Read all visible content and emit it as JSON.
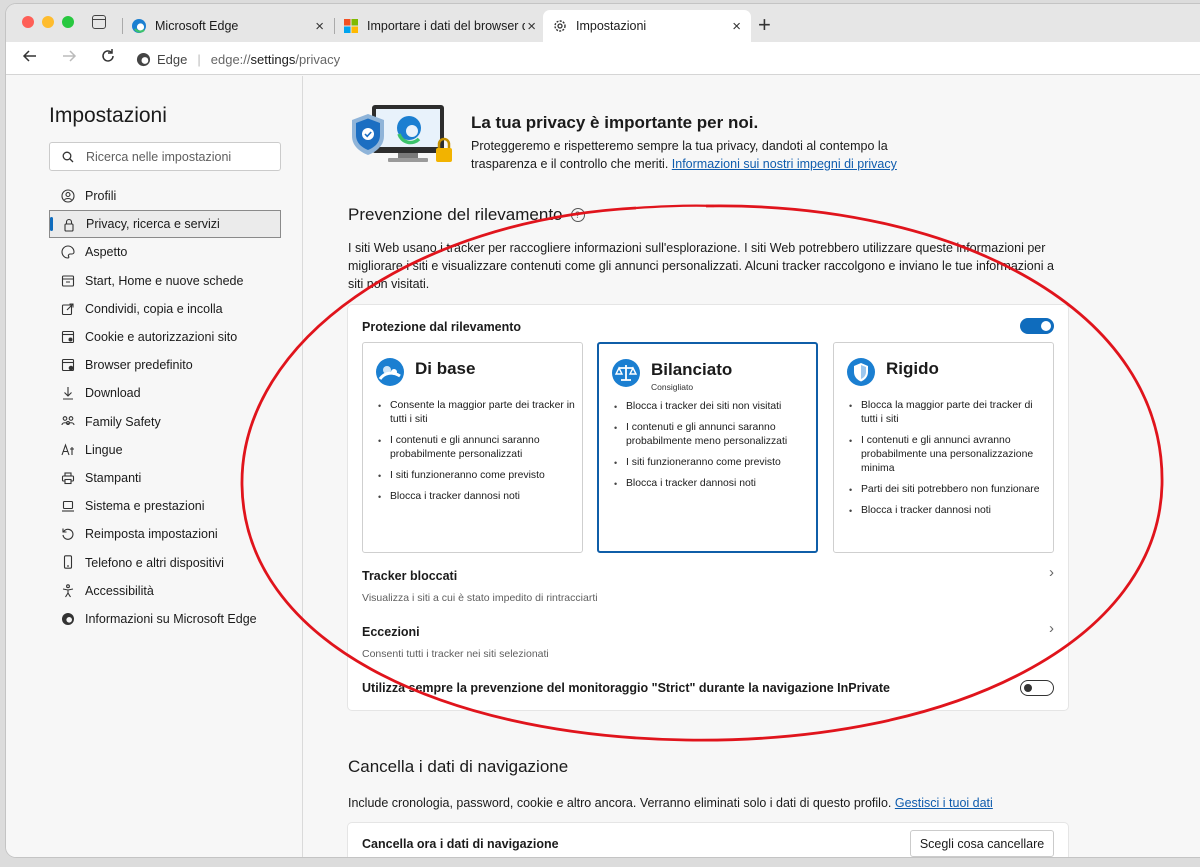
{
  "tabs": [
    {
      "title": "Microsoft Edge",
      "close": "×",
      "icon": "edge-logo"
    },
    {
      "title": "Importare i dati del browser da",
      "close": "×",
      "icon": "microsoft-logo"
    },
    {
      "title": "Impostazioni",
      "close": "×",
      "icon": "gear-icon"
    }
  ],
  "newtab": "+",
  "address": {
    "brand": "Edge",
    "separator": "|",
    "url_prefix": "edge://",
    "url_host": "settings",
    "url_path": "/privacy"
  },
  "sidebar": {
    "title": "Impostazioni",
    "search_placeholder": "Ricerca nelle impostazioni",
    "items": [
      {
        "label": "Profili",
        "icon": "profile-icon"
      },
      {
        "label": "Privacy, ricerca e servizi",
        "icon": "lock-icon"
      },
      {
        "label": "Aspetto",
        "icon": "palette-icon"
      },
      {
        "label": "Start, Home e nuove schede",
        "icon": "home-icon"
      },
      {
        "label": "Condividi, copia e incolla",
        "icon": "share-icon"
      },
      {
        "label": "Cookie e autorizzazioni sito",
        "icon": "cookie-icon"
      },
      {
        "label": "Browser predefinito",
        "icon": "browser-icon"
      },
      {
        "label": "Download",
        "icon": "download-icon"
      },
      {
        "label": "Family Safety",
        "icon": "family-icon"
      },
      {
        "label": "Lingue",
        "icon": "language-icon"
      },
      {
        "label": "Stampanti",
        "icon": "printer-icon"
      },
      {
        "label": "Sistema e prestazioni",
        "icon": "laptop-icon"
      },
      {
        "label": "Reimposta impostazioni",
        "icon": "reset-icon"
      },
      {
        "label": "Telefono e altri dispositivi",
        "icon": "phone-icon"
      },
      {
        "label": "Accessibilità",
        "icon": "accessibility-icon"
      },
      {
        "label": "Informazioni su Microsoft Edge",
        "icon": "edge-logo"
      }
    ]
  },
  "hero": {
    "title": "La tua privacy è importante per noi.",
    "desc": "Proteggeremo e rispetteremo sempre la tua privacy, dandoti al contempo la trasparenza e il controllo che meriti. ",
    "link": "Informazioni sui nostri impegni di privacy"
  },
  "tracking": {
    "title": "Prevenzione del rilevamento",
    "help": "?",
    "desc": "I siti Web usano i tracker per raccogliere informazioni sull'esplorazione. I siti Web potrebbero utilizzare queste informazioni per migliorare i siti e visualizzare contenuti come gli annunci personalizzati. Alcuni tracker raccolgono e inviano le tue informazioni a siti non visitati.",
    "protection_label": "Protezione dal rilevamento",
    "protection_on": true,
    "levels": [
      {
        "name": "Di base",
        "sub": "",
        "selected": false,
        "bullets": [
          "Consente la maggior parte dei tracker in tutti i siti",
          "I contenuti e gli annunci saranno probabilmente personalizzati",
          "I siti funzioneranno come previsto",
          "Blocca i tracker dannosi noti"
        ]
      },
      {
        "name": "Bilanciato",
        "sub": "Consigliato",
        "selected": true,
        "bullets": [
          "Blocca i tracker dei siti non visitati",
          "I contenuti e gli annunci saranno probabilmente meno personalizzati",
          "I siti funzioneranno come previsto",
          "Blocca i tracker dannosi noti"
        ]
      },
      {
        "name": "Rigido",
        "sub": "",
        "selected": false,
        "bullets": [
          "Blocca la maggior parte dei tracker di tutti i siti",
          "I contenuti e gli annunci avranno probabilmente una personalizzazione minima",
          "Parti dei siti potrebbero non funzionare",
          "Blocca i tracker dannosi noti"
        ]
      }
    ],
    "blocked_title": "Tracker bloccati",
    "blocked_sub": "Visualizza i siti a cui è stato impedito di rintracciarti",
    "exceptions_title": "Eccezioni",
    "exceptions_sub": "Consenti tutti i tracker nei siti selezionati",
    "strict_label": "Utilizza sempre la prevenzione del monitoraggio \"Strict\" durante la navigazione InPrivate",
    "strict_on": false,
    "chevron": "›"
  },
  "clear": {
    "title": "Cancella i dati di navigazione",
    "desc": "Include cronologia, password, cookie e altro ancora. Verranno eliminati solo i dati di questo profilo. ",
    "link": "Gestisci i tuoi dati",
    "row_label": "Cancella ora i dati di navigazione",
    "button": "Scegli cosa cancellare"
  },
  "colors": {
    "accent": "#0f6cbd",
    "annotation": "#e0141c"
  }
}
